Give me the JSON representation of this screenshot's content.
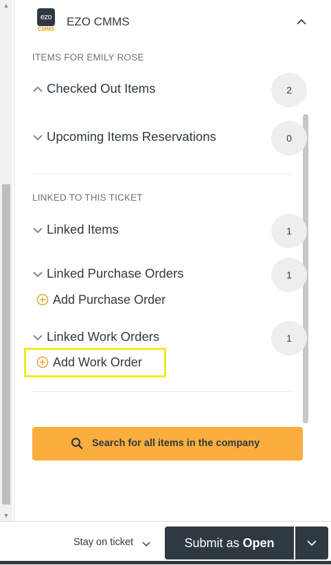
{
  "app": {
    "title": "EZO CMMS",
    "logo_text": "ezo",
    "logo_sub": "CMMS"
  },
  "items_section": {
    "label": "ITEMS FOR EMILY ROSE",
    "rows": [
      {
        "label": "Checked Out Items",
        "count": "2",
        "expanded": true
      },
      {
        "label": "Upcoming Items Reservations",
        "count": "0",
        "expanded": false
      }
    ]
  },
  "linked_section": {
    "label": "LINKED TO THIS TICKET",
    "rows": [
      {
        "label": "Linked Items",
        "count": "1"
      },
      {
        "label": "Linked Purchase Orders",
        "count": "1",
        "add_label": "Add Purchase Order"
      },
      {
        "label": "Linked Work Orders",
        "count": "1",
        "add_label": "Add Work Order"
      }
    ]
  },
  "search_button": {
    "label": "Search for all items in the company"
  },
  "footer": {
    "stay_label": "Stay on ticket",
    "submit_prefix": "Submit as ",
    "submit_status": "Open"
  },
  "colors": {
    "accent": "#fbae3e",
    "dark": "#2f3941",
    "highlight": "#f0ea1b"
  },
  "icons": [
    "chevron-up-icon",
    "chevron-down-icon",
    "plus-circle-icon",
    "search-icon"
  ]
}
